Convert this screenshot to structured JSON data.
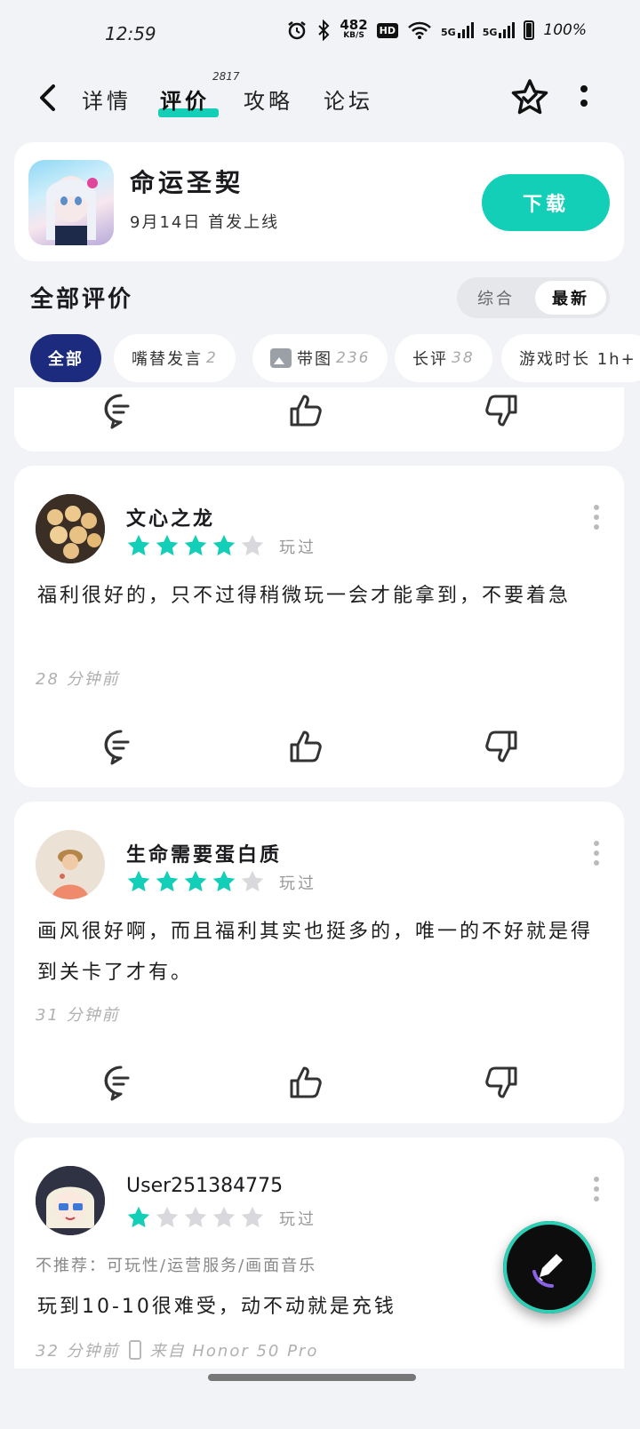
{
  "status": {
    "time": "12:59",
    "net_speed": "482",
    "net_unit": "KB/S",
    "hd": "HD",
    "sig1": "5G",
    "sig2": "5G",
    "battery": "100%"
  },
  "nav": {
    "tabs": [
      {
        "label": "详情"
      },
      {
        "label": "评价"
      },
      {
        "label": "攻略"
      },
      {
        "label": "论坛"
      }
    ],
    "review_count_badge": "2817"
  },
  "game": {
    "title": "命运圣契",
    "subtitle": "9月14日 首发上线",
    "download_label": "下载"
  },
  "reviews_section": {
    "title": "全部评价",
    "sort": {
      "comprehensive": "综合",
      "latest": "最新",
      "selected": "最新"
    }
  },
  "filters": [
    {
      "label": "全部",
      "count": ""
    },
    {
      "label": "嘴替发言",
      "count": "2"
    },
    {
      "label": "带图",
      "count": "236"
    },
    {
      "label": "长评",
      "count": "38"
    },
    {
      "label": "游戏时长 1h+",
      "count": ""
    }
  ],
  "reviews": [
    {
      "user": "文心之龙",
      "rating": 4,
      "status": "玩过",
      "text": "福利很好的，只不过得稍微玩一会才能拿到，不要着急",
      "time": "28 分钟前"
    },
    {
      "user": "生命需要蛋白质",
      "rating": 4,
      "status": "玩过",
      "text": "画风很好啊，而且福利其实也挺多的，唯一的不好就是得到关卡了才有。",
      "time": "31 分钟前"
    },
    {
      "user": "User251384775",
      "rating": 1,
      "status": "玩过",
      "tags": "不推荐：可玩性/运营服务/画面音乐",
      "text": "玩到10-10很难受，动不动就是充钱",
      "time": "32 分钟前",
      "device": "来自 Honor 50 Pro"
    }
  ],
  "colors": {
    "accent": "#14cfb8",
    "chip_active": "#1d2b7e",
    "star_off": "#d9d9dd"
  }
}
